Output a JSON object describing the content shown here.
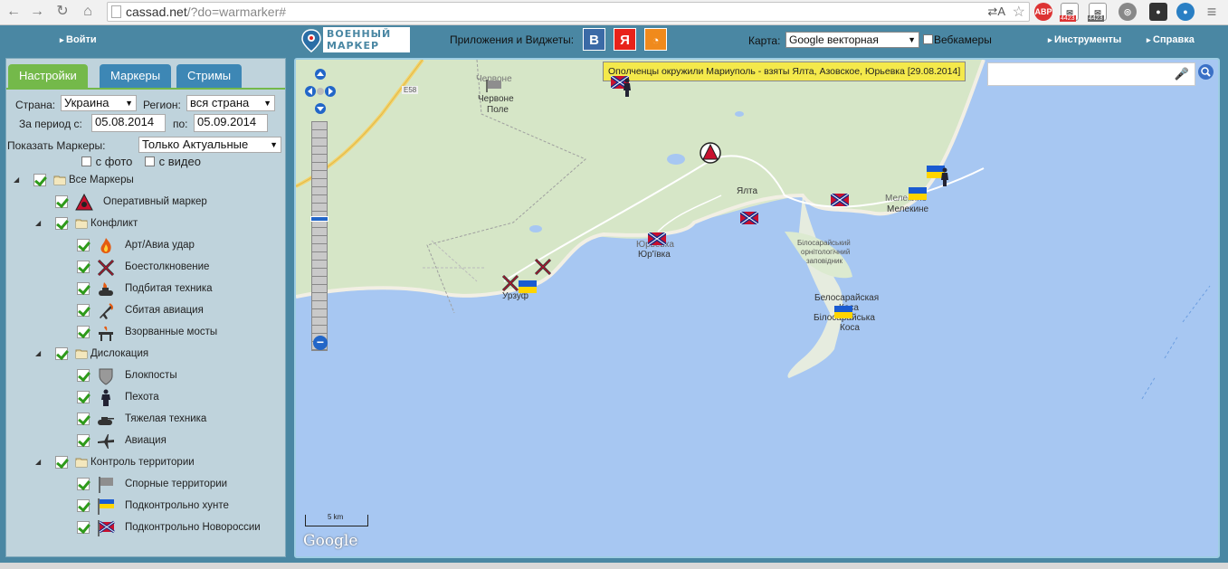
{
  "browser": {
    "url_host": "cassad.net",
    "url_path": "/?do=warmarker#",
    "ext_mail_count": "4423"
  },
  "header": {
    "login": "Войти",
    "logo_line1": "ВОЕННЫЙ",
    "logo_line2": "МАРКЕР",
    "apps_label": "Приложения и Виджеты:",
    "app_vk": "В",
    "app_yandex": "Я",
    "map_label": "Карта:",
    "map_select_value": "Google векторная",
    "webcams": "Вебкамеры",
    "tools": "Инструменты",
    "help": "Справка"
  },
  "sidebar": {
    "tabs": [
      "Настройки",
      "Маркеры",
      "Стримы"
    ],
    "country_label": "Страна:",
    "country_value": "Украина",
    "region_label": "Регион:",
    "region_value": "вся страна",
    "period_label": "За период с:",
    "date_from": "05.08.2014",
    "period_to_label": "по:",
    "date_to": "05.09.2014",
    "show_markers_label": "Показать Маркеры:",
    "show_markers_value": "Только Актуальные",
    "with_photo": "с фото",
    "with_video": "с видео",
    "tree": [
      {
        "label": "Все Маркеры",
        "level": 0,
        "type": "folder"
      },
      {
        "label": "Оперативный маркер",
        "level": 1,
        "type": "marker",
        "icon": "operative-icon"
      },
      {
        "label": "Конфликт",
        "level": 1,
        "type": "folder"
      },
      {
        "label": "Арт/Авиа удар",
        "level": 2,
        "type": "marker",
        "icon": "fire-icon"
      },
      {
        "label": "Боестолкновение",
        "level": 2,
        "type": "marker",
        "icon": "crossed-guns-icon"
      },
      {
        "label": "Подбитая техника",
        "level": 2,
        "type": "marker",
        "icon": "burning-tank-icon"
      },
      {
        "label": "Сбитая авиация",
        "level": 2,
        "type": "marker",
        "icon": "downed-plane-icon"
      },
      {
        "label": "Взорванные мосты",
        "level": 2,
        "type": "marker",
        "icon": "bridge-icon"
      },
      {
        "label": "Дислокация",
        "level": 1,
        "type": "folder"
      },
      {
        "label": "Блокпосты",
        "level": 2,
        "type": "marker",
        "icon": "shield-icon"
      },
      {
        "label": "Пехота",
        "level": 2,
        "type": "marker",
        "icon": "soldier-icon"
      },
      {
        "label": "Тяжелая техника",
        "level": 2,
        "type": "marker",
        "icon": "tank-icon"
      },
      {
        "label": "Авиация",
        "level": 2,
        "type": "marker",
        "icon": "plane-icon"
      },
      {
        "label": "Контроль территории",
        "level": 1,
        "type": "folder"
      },
      {
        "label": "Спорные территории",
        "level": 2,
        "type": "marker",
        "icon": "grey-flag-icon"
      },
      {
        "label": "Подконтрольно хунте",
        "level": 2,
        "type": "marker",
        "icon": "ukraine-flag-icon"
      },
      {
        "label": "Подконтрольно Новороссии",
        "level": 2,
        "type": "marker",
        "icon": "novorossiya-flag-icon"
      }
    ]
  },
  "map": {
    "tooltip": "Ополченцы окружили Мариуполь - взяты Ялта, Азовское, Юрьевка [29.08.2014]",
    "road_label": "E58",
    "places": {
      "chervone1": "Червоне",
      "chervone2": "Червоне",
      "chervone3": "Поле",
      "yalta": "Ялта",
      "melekino1": "Мелекино",
      "melekino2": "Мелекине",
      "yurevka1": "Юрьевка",
      "yurevka2": "Юр'ївка",
      "urzuf1": "Урзуф",
      "reserve1": "Білосарайський",
      "reserve2": "орнітологічний",
      "reserve3": "заповідник",
      "kosa1": "Белосарайская",
      "kosa2": "Коса",
      "kosa3": "Білосарайська",
      "kosa4": "Коса"
    },
    "scale_label": "5 km",
    "attribution": "Google"
  }
}
